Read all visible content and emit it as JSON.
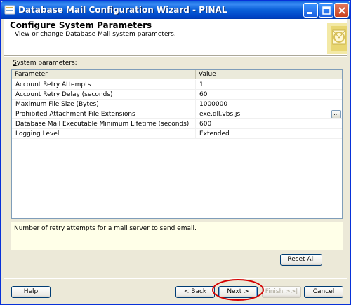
{
  "window": {
    "title": "Database Mail Configuration Wizard - PINAL",
    "icon": "app-icon",
    "controls": [
      "minimize-icon",
      "maximize-icon",
      "close-icon"
    ]
  },
  "header": {
    "title": "Configure System Parameters",
    "subtitle": "View or change Database Mail system parameters."
  },
  "system_parameters_label": {
    "prefix": "",
    "mnemonic": "S",
    "rest": "ystem parameters:"
  },
  "grid": {
    "columns": [
      "Parameter",
      "Value"
    ],
    "rows": [
      {
        "parameter": "Account Retry Attempts",
        "value": "1"
      },
      {
        "parameter": "Account Retry Delay (seconds)",
        "value": "60"
      },
      {
        "parameter": "Maximum File Size (Bytes)",
        "value": "1000000"
      },
      {
        "parameter": "Prohibited Attachment File Extensions",
        "value": "exe,dll,vbs,js",
        "ellipsis": "..."
      },
      {
        "parameter": "Database Mail Executable Minimum Lifetime (seconds)",
        "value": "600"
      },
      {
        "parameter": "Logging Level",
        "value": "Extended"
      }
    ]
  },
  "description": "Number of retry attempts for a mail server to send email.",
  "buttons": {
    "reset_all": {
      "mnemonic": "R",
      "rest": "eset All"
    },
    "help": "Help",
    "back": {
      "prefix": "< ",
      "mnemonic": "B",
      "rest": "ack"
    },
    "next": {
      "mnemonic": "N",
      "rest": "ext >"
    },
    "finish": {
      "mnemonic": "F",
      "rest": "inish >>|"
    },
    "cancel": "Cancel"
  },
  "colors": {
    "titlebar": "#0a5fd8",
    "window_bg": "#ece9d8",
    "description_bg": "#ffffe8",
    "highlight": "#d40000"
  }
}
